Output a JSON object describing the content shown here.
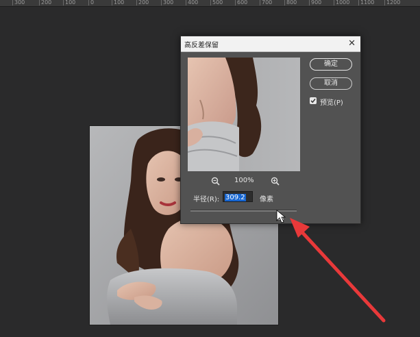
{
  "ruler": {
    "ticks": [
      "300",
      "200",
      "100",
      "0",
      "100",
      "200",
      "300",
      "400",
      "500",
      "600",
      "700",
      "800",
      "900",
      "1000",
      "1100",
      "1200"
    ]
  },
  "dialog": {
    "title": "高反差保留",
    "close_icon": "close-icon",
    "ok_label": "确定",
    "cancel_label": "取消",
    "preview_checkbox": {
      "label": "预览(P)",
      "checked": true
    },
    "zoom": {
      "value": "100%",
      "zoom_out_icon": "zoom-out-icon",
      "zoom_in_icon": "zoom-in-icon"
    },
    "radius": {
      "label": "半径(R):",
      "value": "309.2",
      "unit": "像素"
    }
  },
  "colors": {
    "dialog_bg": "#525252",
    "workspace_bg": "#2a2a2b",
    "selection": "#1766d1",
    "annotation_arrow": "#e8393a"
  }
}
